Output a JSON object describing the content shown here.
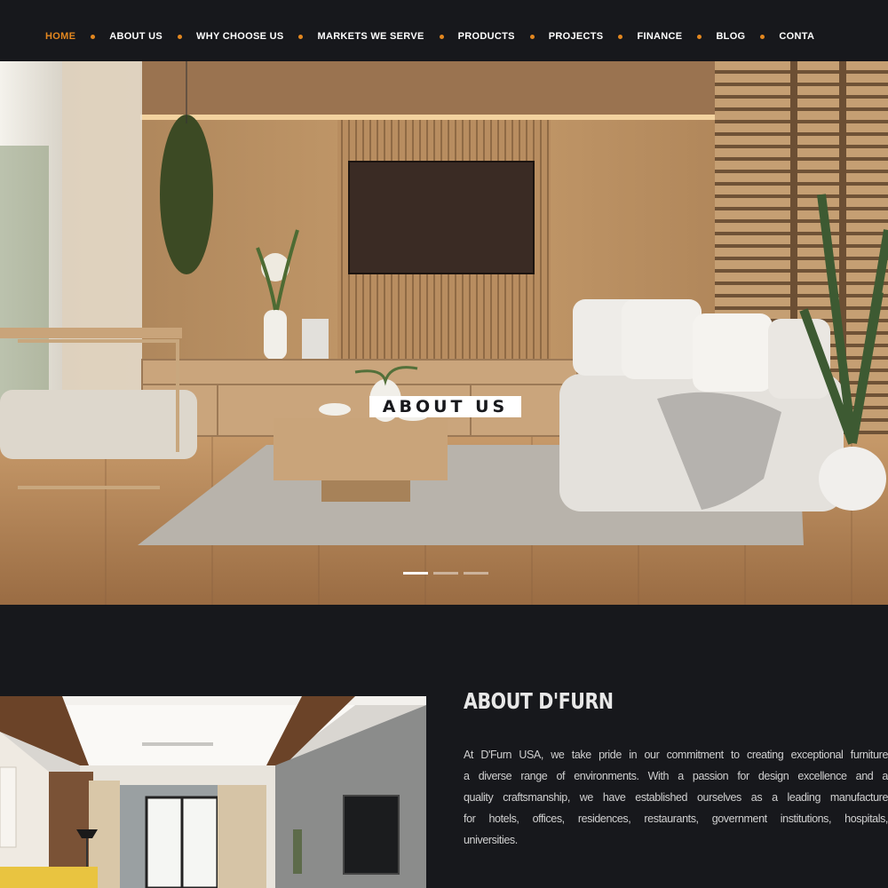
{
  "nav": {
    "items": [
      {
        "label": "HOME",
        "active": true
      },
      {
        "label": "ABOUT US"
      },
      {
        "label": "WHY CHOOSE US"
      },
      {
        "label": "MARKETS WE SERVE"
      },
      {
        "label": "PRODUCTS"
      },
      {
        "label": "PROJECTS"
      },
      {
        "label": "FINANCE"
      },
      {
        "label": "BLOG"
      },
      {
        "label": "CONTA"
      }
    ],
    "accent_color": "#e3871f"
  },
  "hero": {
    "title": "ABOUT US",
    "slides_count": 3,
    "active_slide": 1
  },
  "about": {
    "heading": "ABOUT D'FURN",
    "lines": [
      "At D'Furn USA, we take pride in our commitment to creating exceptional furniture",
      "a diverse range of environments. With a passion for design excellence and a",
      "quality craftsmanship, we have established ourselves as a leading manufacture",
      "for hotels, offices, residences, restaurants, government institutions, hospitals,",
      "universities."
    ]
  }
}
